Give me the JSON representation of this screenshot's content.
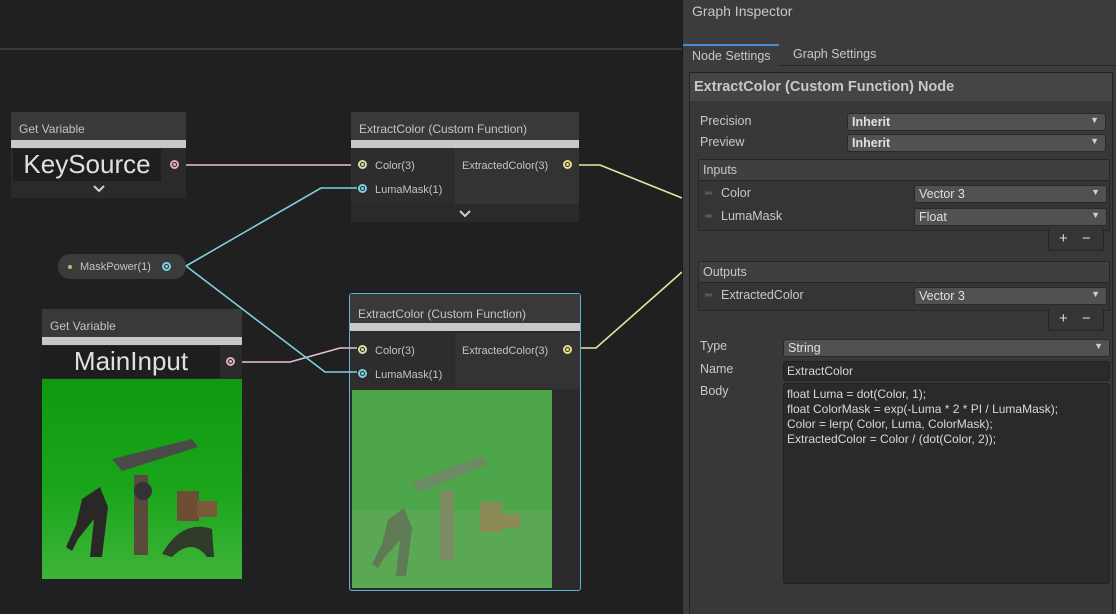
{
  "graph": {
    "nodes": {
      "get_variable_1": {
        "header": "Get Variable",
        "value": "KeySource"
      },
      "get_variable_2": {
        "header": "Get Variable",
        "value": "MainInput"
      },
      "extract_1": {
        "title": "ExtractColor (Custom Function)",
        "inputs": [
          "Color(3)",
          "LumaMask(1)"
        ],
        "output": "ExtractedColor(3)"
      },
      "extract_2": {
        "title": "ExtractColor (Custom Function)",
        "inputs": [
          "Color(3)",
          "LumaMask(1)"
        ],
        "output": "ExtractedColor(3)"
      },
      "mask_power": {
        "label": "MaskPower(1)"
      }
    },
    "colors": {
      "wire_pink": "#e7c0d6",
      "wire_yellow": "#e8e4a0",
      "wire_blue": "#7fd0e0",
      "selection": "#5ab4d8",
      "green_screen": "#16a316"
    }
  },
  "inspector": {
    "title": "Graph Inspector",
    "tabs": [
      "Node Settings",
      "Graph Settings"
    ],
    "active_tab": "Node Settings",
    "node_title": "ExtractColor (Custom Function) Node",
    "precision": {
      "label": "Precision",
      "value": "Inherit"
    },
    "preview": {
      "label": "Preview",
      "value": "Inherit"
    },
    "inputs": {
      "header": "Inputs",
      "rows": [
        {
          "name": "Color",
          "type": "Vector 3"
        },
        {
          "name": "LumaMask",
          "type": "Float"
        }
      ]
    },
    "outputs": {
      "header": "Outputs",
      "rows": [
        {
          "name": "ExtractedColor",
          "type": "Vector 3"
        }
      ]
    },
    "plus": "+",
    "minus": "−",
    "type": {
      "label": "Type",
      "value": "String"
    },
    "name": {
      "label": "Name",
      "value": "ExtractColor"
    },
    "body": {
      "label": "Body",
      "lines": [
        "float Luma = dot(Color, 1);",
        "float ColorMask = exp(-Luma * 2 * PI / LumaMask);",
        "Color = lerp( Color, Luma, ColorMask);",
        "ExtractedColor =  Color / (dot(Color, 2));"
      ]
    }
  }
}
